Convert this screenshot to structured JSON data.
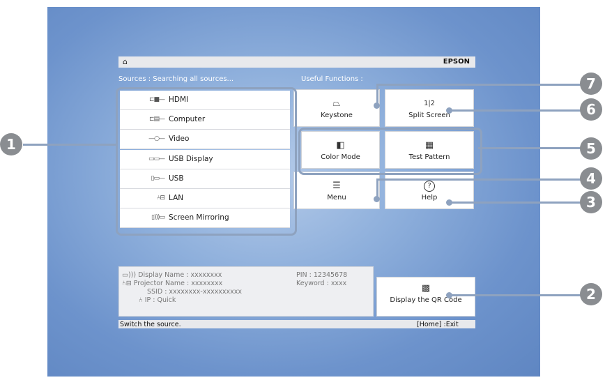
{
  "header": {
    "home_icon": "home-icon",
    "brand": "EPSON"
  },
  "sources": {
    "label": "Sources :  Searching all sources...",
    "items": [
      {
        "label": "HDMI",
        "icon": "hdmi-port-icon"
      },
      {
        "label": "Computer",
        "icon": "computer-port-icon"
      },
      {
        "label": "Video",
        "icon": "video-port-icon"
      },
      {
        "label": "USB Display",
        "icon": "usb-display-port-icon"
      },
      {
        "label": "USB",
        "icon": "usb-port-icon"
      },
      {
        "label": "LAN",
        "icon": "lan-icon"
      },
      {
        "label": "Screen Mirroring",
        "icon": "screen-mirroring-icon"
      }
    ]
  },
  "functions": {
    "label": "Useful Functions :",
    "keystone": "Keystone",
    "split_screen": "Split Screen",
    "split_screen_glyph": "1|2",
    "color_mode": "Color Mode",
    "test_pattern": "Test Pattern",
    "menu": "Menu",
    "help": "Help",
    "help_glyph": "?"
  },
  "network_info": {
    "display_name": "Display Name :  xxxxxxxx",
    "projector_name": "Projector Name :  xxxxxxxx",
    "ssid": "SSID :  xxxxxxxx-xxxxxxxxxx",
    "ip": "IP :  Quick",
    "pin": "PIN :  12345678",
    "keyword": "Keyword :  xxxx"
  },
  "qr": {
    "label": "Display the QR Code"
  },
  "status": {
    "hint": "Switch the source.",
    "exit": "[Home] :Exit"
  },
  "callouts": [
    "1",
    "2",
    "3",
    "4",
    "5",
    "6",
    "7"
  ],
  "colors": {
    "background": "#6d93cc",
    "callout": "#8ea2bf",
    "number_badge": "#8a8d91"
  }
}
